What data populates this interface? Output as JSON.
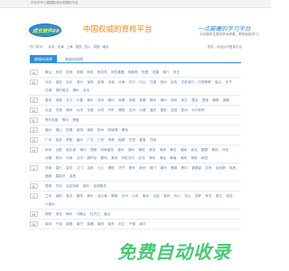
{
  "topbar": {
    "text": "不忘中华儿童国际成长的国际平台"
  },
  "header": {
    "logo_text": "成长软件88",
    "site_title": "中国权威的育校平台",
    "slogan_main": "一点晨曦的学习平台",
    "slogan_sub": "为中国学生提供学术资源，帮你轻松学习！"
  },
  "cityline": {
    "label": "热门城市：",
    "cities": [
      "北京",
      "天津",
      "上海",
      "重庆",
      "四川",
      "成都",
      "南京"
    ]
  },
  "login_hint": {
    "prefix": "您好，欢迎访问",
    "link": "登录",
    "suffix": "平台"
  },
  "tabs": [
    {
      "label": "按城市选择"
    },
    {
      "label": "按省份选择"
    }
  ],
  "rows": [
    {
      "letter": "A",
      "cities": [
        "鞍山",
        "安庆",
        "安阳",
        "安顺",
        "阿坝",
        "阿克苏",
        "阿拉善盟",
        "阿勒泰",
        "阿里",
        "安康",
        "澳门",
        "安丘"
      ]
    },
    {
      "letter": "B",
      "cities": [
        "北京",
        "保定",
        "包头",
        "滨州",
        "宝鸡",
        "蚌埠",
        "本溪",
        "北海",
        "巴中",
        "白山",
        "白银",
        "亳州",
        "百色",
        "巴彦淖尔",
        "巴音郭楞",
        "保山",
        "毕节",
        "白城",
        "博尔塔拉",
        "博州",
        "北屯"
      ]
    },
    {
      "letter": "C",
      "cities": [
        "重庆",
        "成都",
        "长沙",
        "长春",
        "常州",
        "沧州",
        "郴州",
        "赤峰",
        "承德",
        "常德",
        "滁州",
        "潮州",
        "池州",
        "崇左",
        "昌吉",
        "楚雄",
        "朝阳",
        "昌都"
      ]
    },
    {
      "letter": "D",
      "cities": [
        "大连",
        "东莞",
        "德州",
        "大庆",
        "东营",
        "大同",
        "丹东",
        "德阳",
        "达州",
        "大理",
        "迪庆",
        "德宏",
        "定西",
        "儋州",
        "大兴安岭"
      ]
    },
    {
      "letter": "E",
      "cities": [
        "鄂尔多斯",
        "鄂州",
        "恩施"
      ]
    },
    {
      "letter": "F",
      "cities": [
        "福州",
        "佛山",
        "抚顺",
        "阜阳",
        "阜新",
        "抚州",
        "防城港",
        "奉化"
      ]
    },
    {
      "letter": "G",
      "cities": [
        "广州",
        "桂林",
        "贵阳",
        "赣州",
        "广元",
        "广安",
        "贵港",
        "固原",
        "甘孜",
        "果洛",
        "甘南"
      ]
    },
    {
      "letter": "H",
      "cities": [
        "杭州",
        "合肥",
        "哈尔滨",
        "海口",
        "邯郸",
        "呼和浩特",
        "惠州",
        "湖州",
        "衡阳",
        "淮安",
        "菏泽",
        "黄石",
        "淮南",
        "淮北",
        "鹤壁",
        "黄冈",
        "怀化",
        "河源",
        "贺州",
        "河池",
        "汉中",
        "葫芦岛",
        "鹤岗",
        "黑河",
        "呼伦贝尔",
        "红河",
        "海东",
        "海北",
        "黄南",
        "海南",
        "海西",
        "和田"
      ]
    },
    {
      "letter": "J",
      "cities": [
        "济南",
        "嘉兴",
        "金华",
        "江门",
        "吉林",
        "九江",
        "揭阳",
        "济宁",
        "焦作",
        "荆州",
        "荆门",
        "锦州",
        "晋城",
        "晋中",
        "景德镇",
        "吉安",
        "佳木斯",
        "鸡西",
        "酒泉",
        "嘉峪关",
        "金昌"
      ]
    },
    {
      "letter": "K",
      "cities": [
        "昆明",
        "开封",
        "克拉玛依",
        "喀什",
        "克孜勒苏"
      ]
    },
    {
      "letter": "L",
      "cities": [
        "兰州",
        "洛阳",
        "临沂",
        "廊坊",
        "柳州",
        "连云港",
        "聊城",
        "泸州",
        "六安",
        "丽水",
        "龙岩",
        "娄底",
        "乐山",
        "凉山",
        "拉萨",
        "林芝",
        "丽江",
        "临沧",
        "六盘水"
      ]
    },
    {
      "letter": "M",
      "cities": [
        "绵阳",
        "茂名",
        "梅州",
        "马鞍山",
        "牡丹江",
        "眉山"
      ]
    },
    {
      "letter": "N",
      "cities": [
        "南京",
        "宁波",
        "南昌",
        "南宁",
        "南通",
        "南阳",
        "南充",
        "内江",
        "宁德",
        "南平"
      ]
    }
  ],
  "watermark": {
    "text": "免费自动收录"
  }
}
